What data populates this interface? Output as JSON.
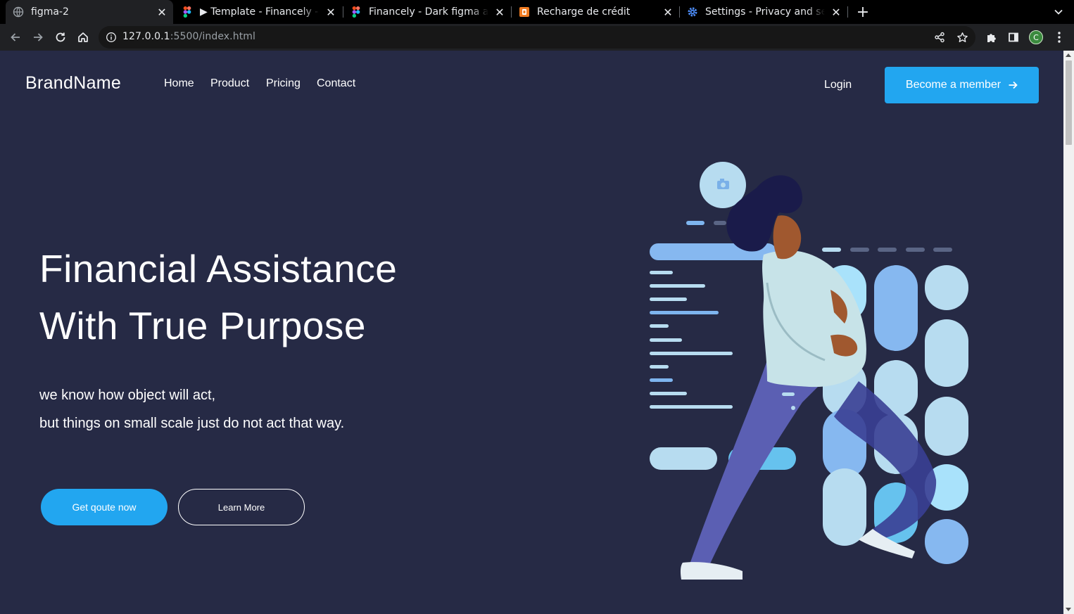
{
  "browser": {
    "tabs": [
      {
        "title": "figma-2",
        "favicon": "globe-icon",
        "active": true
      },
      {
        "title": "▶ Template - Financely - Dark figma and css",
        "favicon": "figma-icon",
        "active": false
      },
      {
        "title": "Financely - Dark figma and css",
        "favicon": "figma-icon",
        "active": false
      },
      {
        "title": "Recharge de crédit",
        "favicon": "orange-app-icon",
        "active": false
      },
      {
        "title": "Settings - Privacy and security",
        "favicon": "gear-icon",
        "active": false
      }
    ],
    "url": {
      "host": "127.0.0.1",
      "path": ":5500/index.html"
    },
    "profile_initial": "C",
    "colors": {
      "tabstrip": "#000000",
      "toolbar": "#202124",
      "accent_profile": "#3b8a3e"
    }
  },
  "site": {
    "brand": "BrandName",
    "nav": [
      "Home",
      "Product",
      "Pricing",
      "Contact"
    ],
    "login": "Login",
    "member_button": "Become a member",
    "hero": {
      "title_line1": "Financial Assistance",
      "title_line2": "With True Purpose",
      "sub_line1": "we know how object will act,",
      "sub_line2": "but things on small scale just do not act that way.",
      "primary_cta": "Get qoute now",
      "secondary_cta": "Learn More"
    },
    "colors": {
      "background": "#262a45",
      "accent": "#22a6f0",
      "text": "#ffffff"
    }
  }
}
